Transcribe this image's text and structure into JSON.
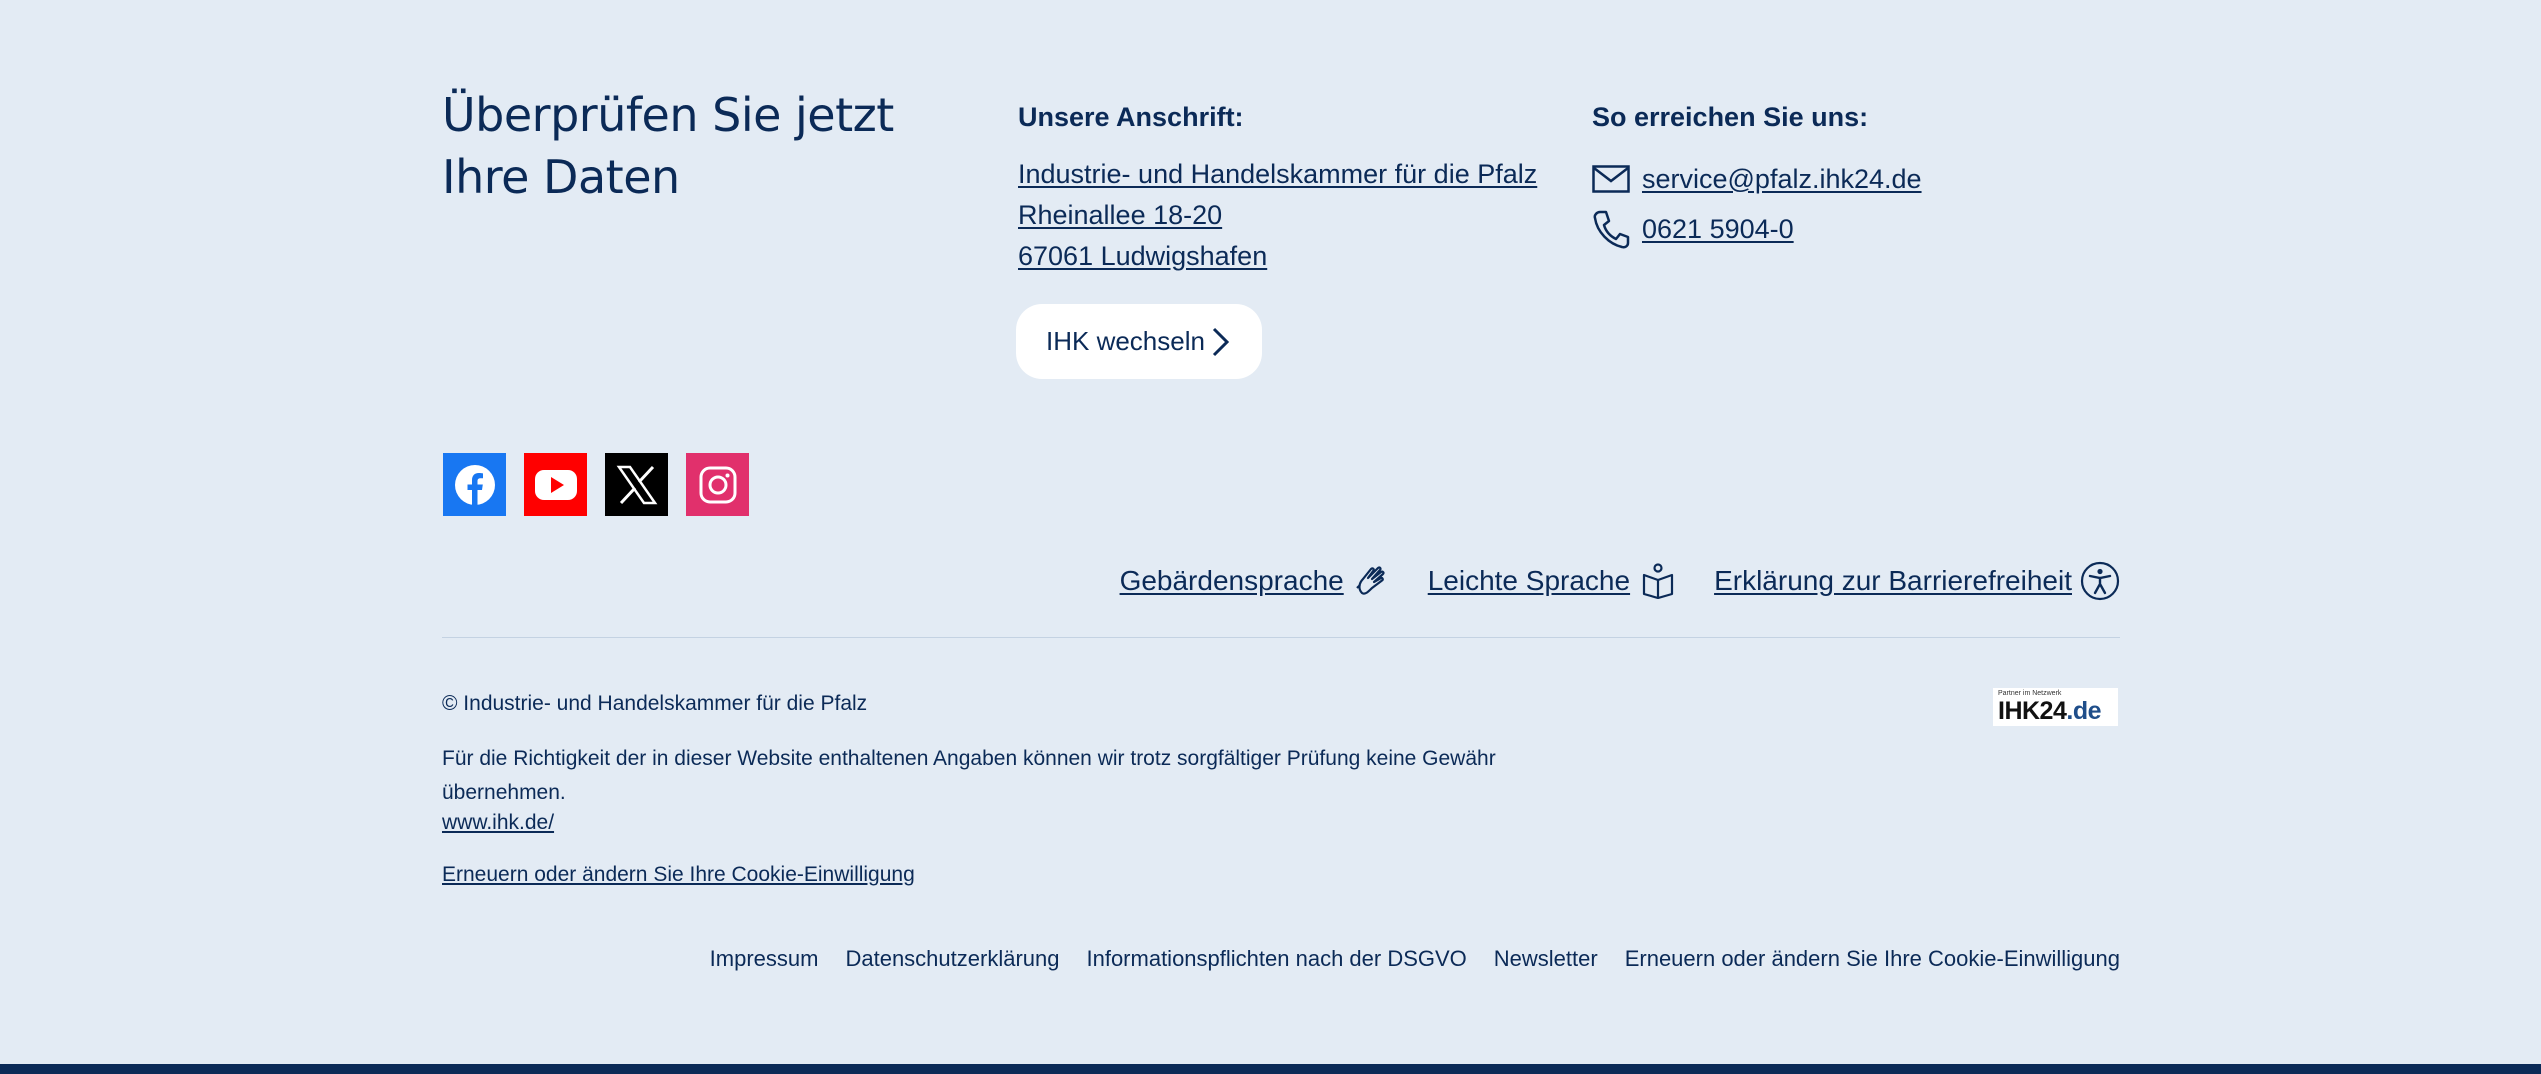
{
  "heading": "Überprüfen Sie jetzt Ihre Daten",
  "address": {
    "title": "Unsere Anschrift:",
    "lines": [
      "Industrie- und Handelskammer für die Pfalz",
      "Rheinallee 18-20",
      "67061 Ludwigshafen"
    ],
    "switch_label": "IHK wechseln"
  },
  "contact": {
    "title": "So erreichen Sie uns:",
    "email": "service@pfalz.ihk24.de",
    "phone": "0621 5904-0"
  },
  "social": {
    "icons": [
      "facebook-icon",
      "youtube-icon",
      "x-icon",
      "instagram-icon"
    ],
    "colors": {
      "facebook": "#1877f2",
      "youtube": "#ff0000",
      "x": "#000000",
      "instagram": "#e1306c"
    }
  },
  "accessibility": {
    "sign_language": "Gebärdensprache",
    "easy_language": "Leichte Sprache",
    "statement": "Erklärung zur Barrierefreiheit"
  },
  "legal": {
    "copyright": "© Industrie- und Handelskammer für die Pfalz",
    "disclaimer": "Für die Richtigkeit der in dieser Website enthaltenen Angaben können wir trotz sorgfältiger Prüfung keine Gewähr übernehmen.",
    "ihk_link": "www.ihk.de/",
    "cookie_link": "Erneuern oder ändern Sie Ihre Cookie-Einwilligung"
  },
  "logo": {
    "tagline": "Partner im Netzwerk",
    "name": "IHK24",
    "suffix": ".de"
  },
  "bottom_nav": [
    "Impressum",
    "Datenschutzerklärung",
    "Informationspflichten nach der DSGVO",
    "Newsletter",
    "Erneuern oder ändern Sie Ihre Cookie-Einwilligung"
  ],
  "colors": {
    "background": "#e3ebf4",
    "text": "#0b2a57",
    "bar": "#0b2a57"
  }
}
